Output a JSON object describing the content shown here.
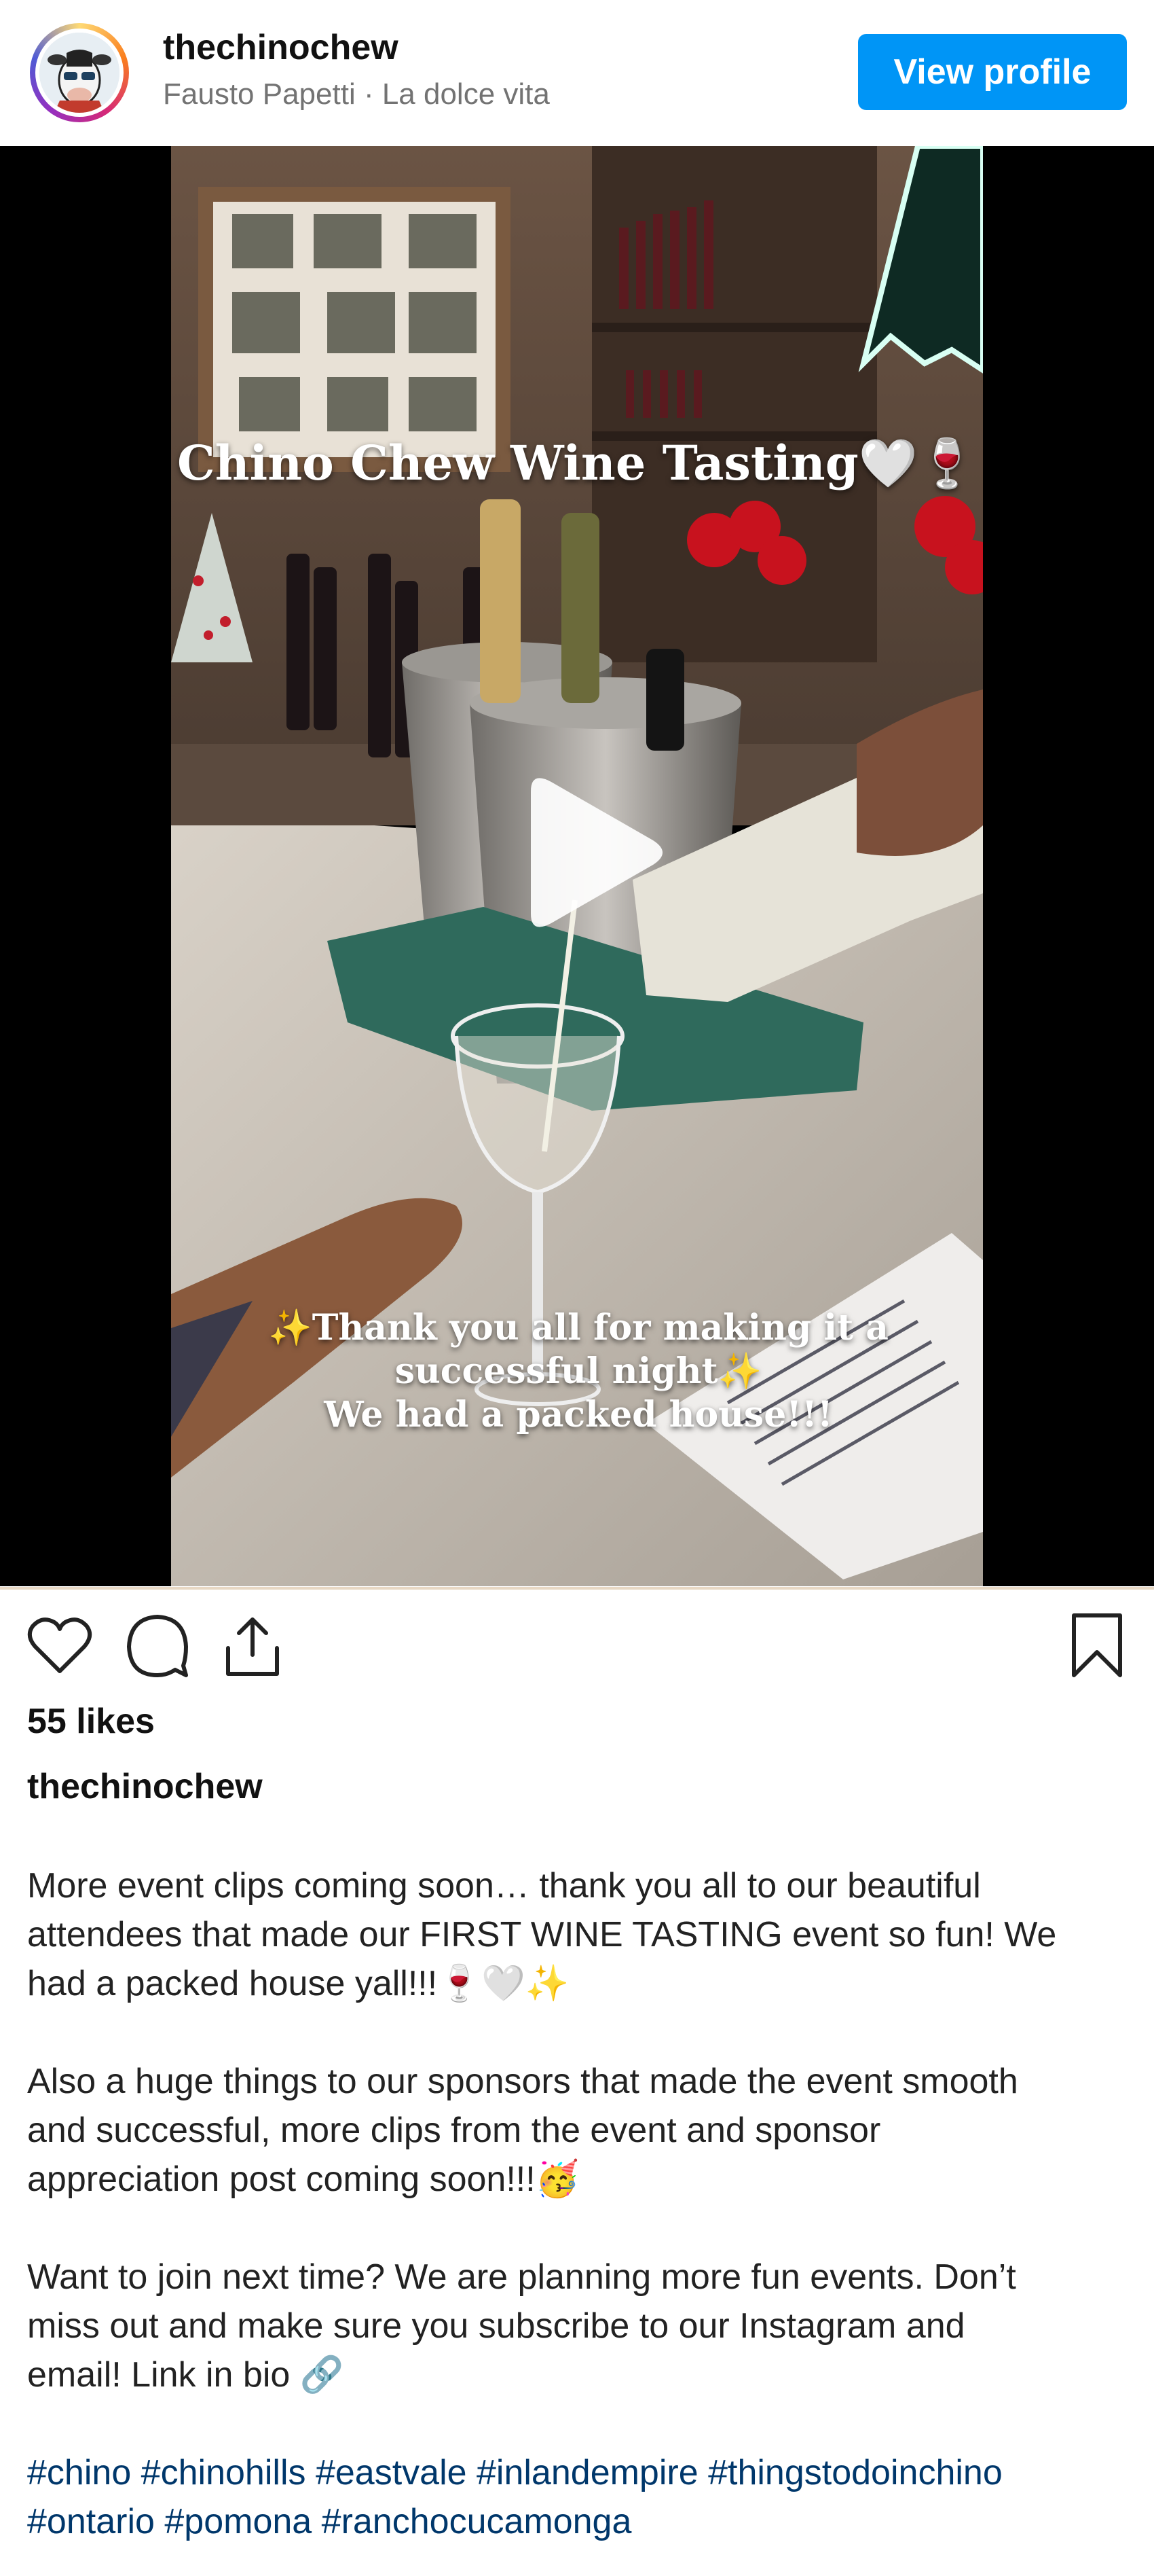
{
  "header": {
    "username": "thechinochew",
    "subtitle": "Fausto Papetti · La dolce vita",
    "view_profile_label": "View profile"
  },
  "media": {
    "overlay_title": "Chino Chew Wine Tasting🤍🍷",
    "overlay_lines": [
      "✨Thank you all for making it a",
      "successful night✨",
      "We had a packed house!!!"
    ]
  },
  "actions": {
    "icons": [
      "heart-icon",
      "comment-icon",
      "share-icon",
      "bookmark-icon"
    ]
  },
  "post": {
    "likes": "55 likes",
    "author": "thechinochew",
    "paragraph1": [
      "More event clips coming soon… thank you all to our beautiful",
      "attendees that made our FIRST WINE TASTING event so fun! We",
      "had a packed house yall!!!🍷🤍✨"
    ],
    "paragraph2": [
      "Also a huge things to our sponsors that made the event smooth",
      "and successful, more clips from the event and sponsor",
      "appreciation post coming soon!!!🥳"
    ],
    "paragraph3": [
      "Want to join next time? We are planning more fun events. Don’t",
      "miss out and make sure you subscribe to our Instagram and",
      "email! Link in bio 🔗"
    ],
    "hashtags": [
      "#chino #chinohills #eastvale #inlandempire #thingstodoinchino",
      "#ontario #pomona #ranchocucamonga"
    ]
  },
  "colors": {
    "accent": "#0095f6",
    "hashtag": "#00376b",
    "secondary_text": "#737373"
  }
}
